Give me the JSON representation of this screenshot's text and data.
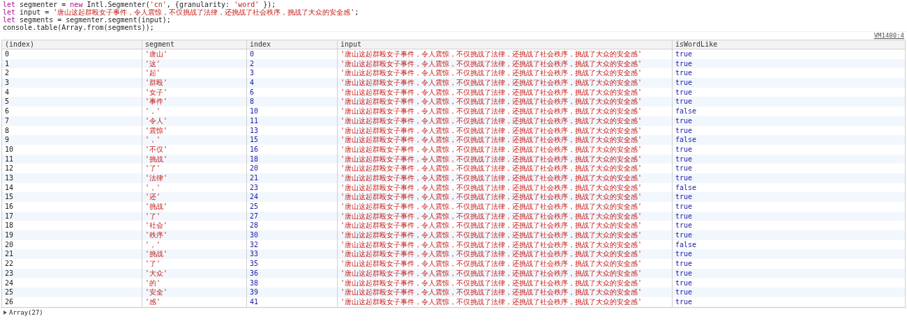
{
  "code_lines": [
    [
      {
        "kind": "keyword",
        "text": "let"
      },
      {
        "kind": "plain",
        "text": " segmenter = "
      },
      {
        "kind": "keyword",
        "text": "new"
      },
      {
        "kind": "plain",
        "text": " Intl.Segmenter("
      },
      {
        "kind": "string",
        "text": "'cn'"
      },
      {
        "kind": "plain",
        "text": ", {granularity: "
      },
      {
        "kind": "string",
        "text": "'word'"
      },
      {
        "kind": "plain",
        "text": " });"
      }
    ],
    [
      {
        "kind": "keyword",
        "text": "let"
      },
      {
        "kind": "plain",
        "text": " input = "
      },
      {
        "kind": "string",
        "text": "'唐山这起群殴女子事件，令人震惊，不仅挑战了法律，还挑战了社会秩序，挑战了大众的安全感'"
      },
      {
        "kind": "plain",
        "text": ";"
      }
    ],
    [
      {
        "kind": "keyword",
        "text": "let"
      },
      {
        "kind": "plain",
        "text": " segments = segmenter.segment(input);"
      }
    ],
    [
      {
        "kind": "plain",
        "text": "console.table(Array.from(segments));"
      }
    ]
  ],
  "source_link": "VM1480:4",
  "table": {
    "columns": [
      "(index)",
      "segment",
      "index",
      "input",
      "isWordLike"
    ],
    "rows": [
      [
        "0",
        "'唐山'",
        "0",
        "'唐山这起群殴女子事件，令人震惊，不仅挑战了法律，还挑战了社会秩序，挑战了大众的安全感'",
        "true"
      ],
      [
        "1",
        "'这'",
        "2",
        "'唐山这起群殴女子事件，令人震惊，不仅挑战了法律，还挑战了社会秩序，挑战了大众的安全感'",
        "true"
      ],
      [
        "2",
        "'起'",
        "3",
        "'唐山这起群殴女子事件，令人震惊，不仅挑战了法律，还挑战了社会秩序，挑战了大众的安全感'",
        "true"
      ],
      [
        "3",
        "'群殴'",
        "4",
        "'唐山这起群殴女子事件，令人震惊，不仅挑战了法律，还挑战了社会秩序，挑战了大众的安全感'",
        "true"
      ],
      [
        "4",
        "'女子'",
        "6",
        "'唐山这起群殴女子事件，令人震惊，不仅挑战了法律，还挑战了社会秩序，挑战了大众的安全感'",
        "true"
      ],
      [
        "5",
        "'事件'",
        "8",
        "'唐山这起群殴女子事件，令人震惊，不仅挑战了法律，还挑战了社会秩序，挑战了大众的安全感'",
        "true"
      ],
      [
        "6",
        "'，'",
        "10",
        "'唐山这起群殴女子事件，令人震惊，不仅挑战了法律，还挑战了社会秩序，挑战了大众的安全感'",
        "false"
      ],
      [
        "7",
        "'令人'",
        "11",
        "'唐山这起群殴女子事件，令人震惊，不仅挑战了法律，还挑战了社会秩序，挑战了大众的安全感'",
        "true"
      ],
      [
        "8",
        "'震惊'",
        "13",
        "'唐山这起群殴女子事件，令人震惊，不仅挑战了法律，还挑战了社会秩序，挑战了大众的安全感'",
        "true"
      ],
      [
        "9",
        "'，'",
        "15",
        "'唐山这起群殴女子事件，令人震惊，不仅挑战了法律，还挑战了社会秩序，挑战了大众的安全感'",
        "false"
      ],
      [
        "10",
        "'不仅'",
        "16",
        "'唐山这起群殴女子事件，令人震惊，不仅挑战了法律，还挑战了社会秩序，挑战了大众的安全感'",
        "true"
      ],
      [
        "11",
        "'挑战'",
        "18",
        "'唐山这起群殴女子事件，令人震惊，不仅挑战了法律，还挑战了社会秩序，挑战了大众的安全感'",
        "true"
      ],
      [
        "12",
        "'了'",
        "20",
        "'唐山这起群殴女子事件，令人震惊，不仅挑战了法律，还挑战了社会秩序，挑战了大众的安全感'",
        "true"
      ],
      [
        "13",
        "'法律'",
        "21",
        "'唐山这起群殴女子事件，令人震惊，不仅挑战了法律，还挑战了社会秩序，挑战了大众的安全感'",
        "true"
      ],
      [
        "14",
        "'，'",
        "23",
        "'唐山这起群殴女子事件，令人震惊，不仅挑战了法律，还挑战了社会秩序，挑战了大众的安全感'",
        "false"
      ],
      [
        "15",
        "'还'",
        "24",
        "'唐山这起群殴女子事件，令人震惊，不仅挑战了法律，还挑战了社会秩序，挑战了大众的安全感'",
        "true"
      ],
      [
        "16",
        "'挑战'",
        "25",
        "'唐山这起群殴女子事件，令人震惊，不仅挑战了法律，还挑战了社会秩序，挑战了大众的安全感'",
        "true"
      ],
      [
        "17",
        "'了'",
        "27",
        "'唐山这起群殴女子事件，令人震惊，不仅挑战了法律，还挑战了社会秩序，挑战了大众的安全感'",
        "true"
      ],
      [
        "18",
        "'社会'",
        "28",
        "'唐山这起群殴女子事件，令人震惊，不仅挑战了法律，还挑战了社会秩序，挑战了大众的安全感'",
        "true"
      ],
      [
        "19",
        "'秩序'",
        "30",
        "'唐山这起群殴女子事件，令人震惊，不仅挑战了法律，还挑战了社会秩序，挑战了大众的安全感'",
        "true"
      ],
      [
        "20",
        "'，'",
        "32",
        "'唐山这起群殴女子事件，令人震惊，不仅挑战了法律，还挑战了社会秩序，挑战了大众的安全感'",
        "false"
      ],
      [
        "21",
        "'挑战'",
        "33",
        "'唐山这起群殴女子事件，令人震惊，不仅挑战了法律，还挑战了社会秩序，挑战了大众的安全感'",
        "true"
      ],
      [
        "22",
        "'了'",
        "35",
        "'唐山这起群殴女子事件，令人震惊，不仅挑战了法律，还挑战了社会秩序，挑战了大众的安全感'",
        "true"
      ],
      [
        "23",
        "'大众'",
        "36",
        "'唐山这起群殴女子事件，令人震惊，不仅挑战了法律，还挑战了社会秩序，挑战了大众的安全感'",
        "true"
      ],
      [
        "24",
        "'的'",
        "38",
        "'唐山这起群殴女子事件，令人震惊，不仅挑战了法律，还挑战了社会秩序，挑战了大众的安全感'",
        "true"
      ],
      [
        "25",
        "'安全'",
        "39",
        "'唐山这起群殴女子事件，令人震惊，不仅挑战了法律，还挑战了社会秩序，挑战了大众的安全感'",
        "true"
      ],
      [
        "26",
        "'感'",
        "41",
        "'唐山这起群殴女子事件，令人震惊，不仅挑战了法律，还挑战了社会秩序，挑战了大众的安全感'",
        "true"
      ]
    ]
  },
  "result": {
    "expanded": false,
    "summary": "Array(27)"
  }
}
